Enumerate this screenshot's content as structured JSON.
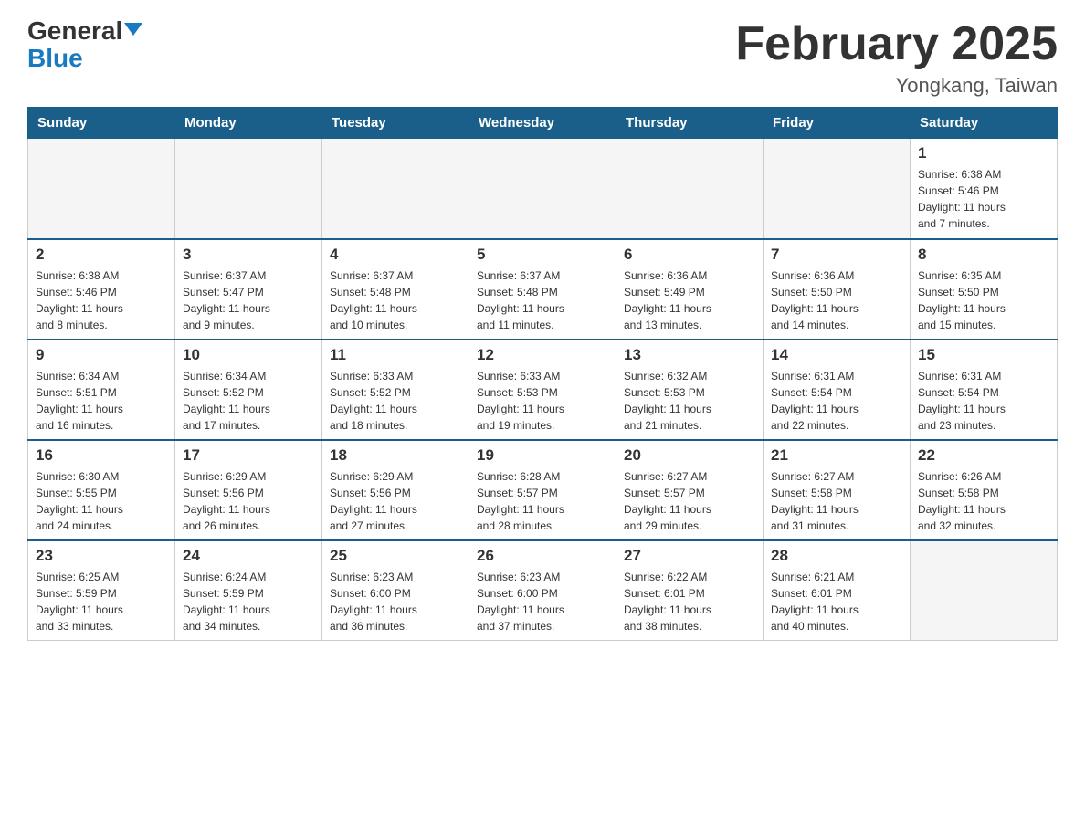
{
  "header": {
    "logo_general": "General",
    "logo_blue": "Blue",
    "month_year": "February 2025",
    "location": "Yongkang, Taiwan"
  },
  "days_of_week": [
    "Sunday",
    "Monday",
    "Tuesday",
    "Wednesday",
    "Thursday",
    "Friday",
    "Saturday"
  ],
  "weeks": [
    [
      {
        "day": "",
        "info": ""
      },
      {
        "day": "",
        "info": ""
      },
      {
        "day": "",
        "info": ""
      },
      {
        "day": "",
        "info": ""
      },
      {
        "day": "",
        "info": ""
      },
      {
        "day": "",
        "info": ""
      },
      {
        "day": "1",
        "info": "Sunrise: 6:38 AM\nSunset: 5:46 PM\nDaylight: 11 hours\nand 7 minutes."
      }
    ],
    [
      {
        "day": "2",
        "info": "Sunrise: 6:38 AM\nSunset: 5:46 PM\nDaylight: 11 hours\nand 8 minutes."
      },
      {
        "day": "3",
        "info": "Sunrise: 6:37 AM\nSunset: 5:47 PM\nDaylight: 11 hours\nand 9 minutes."
      },
      {
        "day": "4",
        "info": "Sunrise: 6:37 AM\nSunset: 5:48 PM\nDaylight: 11 hours\nand 10 minutes."
      },
      {
        "day": "5",
        "info": "Sunrise: 6:37 AM\nSunset: 5:48 PM\nDaylight: 11 hours\nand 11 minutes."
      },
      {
        "day": "6",
        "info": "Sunrise: 6:36 AM\nSunset: 5:49 PM\nDaylight: 11 hours\nand 13 minutes."
      },
      {
        "day": "7",
        "info": "Sunrise: 6:36 AM\nSunset: 5:50 PM\nDaylight: 11 hours\nand 14 minutes."
      },
      {
        "day": "8",
        "info": "Sunrise: 6:35 AM\nSunset: 5:50 PM\nDaylight: 11 hours\nand 15 minutes."
      }
    ],
    [
      {
        "day": "9",
        "info": "Sunrise: 6:34 AM\nSunset: 5:51 PM\nDaylight: 11 hours\nand 16 minutes."
      },
      {
        "day": "10",
        "info": "Sunrise: 6:34 AM\nSunset: 5:52 PM\nDaylight: 11 hours\nand 17 minutes."
      },
      {
        "day": "11",
        "info": "Sunrise: 6:33 AM\nSunset: 5:52 PM\nDaylight: 11 hours\nand 18 minutes."
      },
      {
        "day": "12",
        "info": "Sunrise: 6:33 AM\nSunset: 5:53 PM\nDaylight: 11 hours\nand 19 minutes."
      },
      {
        "day": "13",
        "info": "Sunrise: 6:32 AM\nSunset: 5:53 PM\nDaylight: 11 hours\nand 21 minutes."
      },
      {
        "day": "14",
        "info": "Sunrise: 6:31 AM\nSunset: 5:54 PM\nDaylight: 11 hours\nand 22 minutes."
      },
      {
        "day": "15",
        "info": "Sunrise: 6:31 AM\nSunset: 5:54 PM\nDaylight: 11 hours\nand 23 minutes."
      }
    ],
    [
      {
        "day": "16",
        "info": "Sunrise: 6:30 AM\nSunset: 5:55 PM\nDaylight: 11 hours\nand 24 minutes."
      },
      {
        "day": "17",
        "info": "Sunrise: 6:29 AM\nSunset: 5:56 PM\nDaylight: 11 hours\nand 26 minutes."
      },
      {
        "day": "18",
        "info": "Sunrise: 6:29 AM\nSunset: 5:56 PM\nDaylight: 11 hours\nand 27 minutes."
      },
      {
        "day": "19",
        "info": "Sunrise: 6:28 AM\nSunset: 5:57 PM\nDaylight: 11 hours\nand 28 minutes."
      },
      {
        "day": "20",
        "info": "Sunrise: 6:27 AM\nSunset: 5:57 PM\nDaylight: 11 hours\nand 29 minutes."
      },
      {
        "day": "21",
        "info": "Sunrise: 6:27 AM\nSunset: 5:58 PM\nDaylight: 11 hours\nand 31 minutes."
      },
      {
        "day": "22",
        "info": "Sunrise: 6:26 AM\nSunset: 5:58 PM\nDaylight: 11 hours\nand 32 minutes."
      }
    ],
    [
      {
        "day": "23",
        "info": "Sunrise: 6:25 AM\nSunset: 5:59 PM\nDaylight: 11 hours\nand 33 minutes."
      },
      {
        "day": "24",
        "info": "Sunrise: 6:24 AM\nSunset: 5:59 PM\nDaylight: 11 hours\nand 34 minutes."
      },
      {
        "day": "25",
        "info": "Sunrise: 6:23 AM\nSunset: 6:00 PM\nDaylight: 11 hours\nand 36 minutes."
      },
      {
        "day": "26",
        "info": "Sunrise: 6:23 AM\nSunset: 6:00 PM\nDaylight: 11 hours\nand 37 minutes."
      },
      {
        "day": "27",
        "info": "Sunrise: 6:22 AM\nSunset: 6:01 PM\nDaylight: 11 hours\nand 38 minutes."
      },
      {
        "day": "28",
        "info": "Sunrise: 6:21 AM\nSunset: 6:01 PM\nDaylight: 11 hours\nand 40 minutes."
      },
      {
        "day": "",
        "info": ""
      }
    ]
  ]
}
